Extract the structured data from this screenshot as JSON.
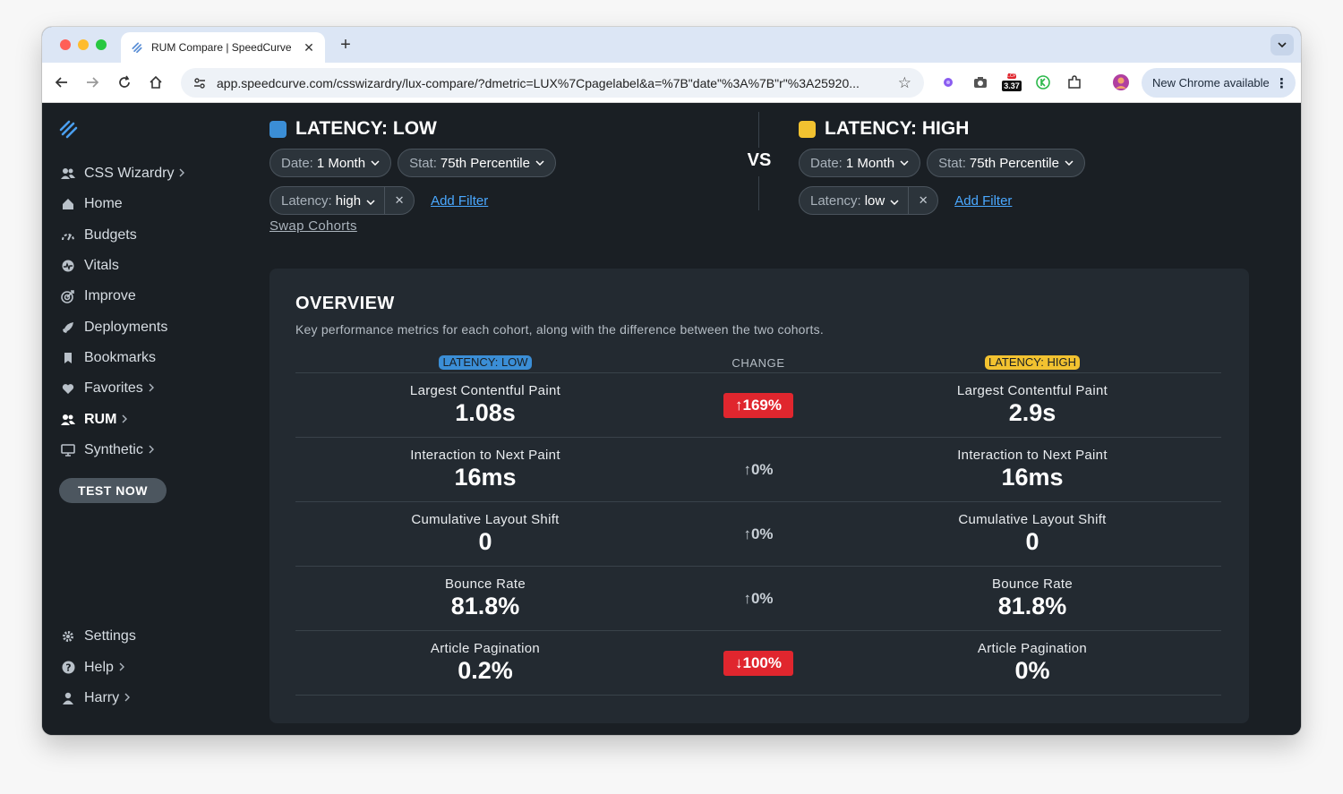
{
  "browser": {
    "tab_title": "RUM Compare | SpeedCurve",
    "tab_close": "✕",
    "new_tab": "+",
    "url": "app.speedcurve.com/csswizardry/lux-compare/?dmetric=LUX%7Cpagelabel&a=%7B\"date\"%3A%7B\"r\"%3A25920...",
    "lcp_badge_top": "LCP",
    "lcp_badge_value": "3.37",
    "new_chrome": "New Chrome available"
  },
  "sidebar": {
    "items": [
      {
        "label": "CSS Wizardry",
        "icon": "team-icon",
        "chevron": true
      },
      {
        "label": "Home",
        "icon": "home-icon",
        "chevron": false
      },
      {
        "label": "Budgets",
        "icon": "gauge-icon",
        "chevron": false
      },
      {
        "label": "Vitals",
        "icon": "vitals-icon",
        "chevron": false
      },
      {
        "label": "Improve",
        "icon": "target-icon",
        "chevron": false
      },
      {
        "label": "Deployments",
        "icon": "rocket-icon",
        "chevron": false
      },
      {
        "label": "Bookmarks",
        "icon": "bookmark-icon",
        "chevron": false
      },
      {
        "label": "Favorites",
        "icon": "heart-icon",
        "chevron": true
      },
      {
        "label": "RUM",
        "icon": "users-icon",
        "chevron": true,
        "active": true
      },
      {
        "label": "Synthetic",
        "icon": "monitor-icon",
        "chevron": true
      }
    ],
    "test_now": "TEST NOW",
    "bottom_items": [
      {
        "label": "Settings",
        "icon": "gear-icon",
        "chevron": false
      },
      {
        "label": "Help",
        "icon": "help-icon",
        "chevron": true
      },
      {
        "label": "Harry",
        "icon": "user-icon",
        "chevron": true
      }
    ]
  },
  "cohorts": {
    "left": {
      "title": "LATENCY: LOW",
      "color": "#3b8ed6",
      "date_key": "Date:",
      "date_value": "1 Month",
      "stat_key": "Stat:",
      "stat_value": "75th Percentile",
      "filter_key": "Latency:",
      "filter_value": "high",
      "add_filter": "Add Filter"
    },
    "right": {
      "title": "LATENCY: HIGH",
      "color": "#f2c230",
      "date_key": "Date:",
      "date_value": "1 Month",
      "stat_key": "Stat:",
      "stat_value": "75th Percentile",
      "filter_key": "Latency:",
      "filter_value": "low",
      "add_filter": "Add Filter"
    },
    "vs": "VS",
    "swap": "Swap Cohorts"
  },
  "overview": {
    "title": "OVERVIEW",
    "description": "Key performance metrics for each cohort, along with the difference between the two cohorts.",
    "col_left": "LATENCY: LOW",
    "col_change": "CHANGE",
    "col_right": "LATENCY: HIGH",
    "rows": [
      {
        "metric": "Largest Contentful Paint",
        "left": "1.08s",
        "change": "↑169%",
        "bad": true,
        "right": "2.9s"
      },
      {
        "metric": "Interaction to Next Paint",
        "left": "16ms",
        "change": "↑0%",
        "bad": false,
        "right": "16ms"
      },
      {
        "metric": "Cumulative Layout Shift",
        "left": "0",
        "change": "↑0%",
        "bad": false,
        "right": "0"
      },
      {
        "metric": "Bounce Rate",
        "left": "81.8%",
        "change": "↑0%",
        "bad": false,
        "right": "81.8%"
      },
      {
        "metric": "Article Pagination",
        "left": "0.2%",
        "change": "↓100%",
        "bad": true,
        "right": "0%"
      }
    ]
  }
}
